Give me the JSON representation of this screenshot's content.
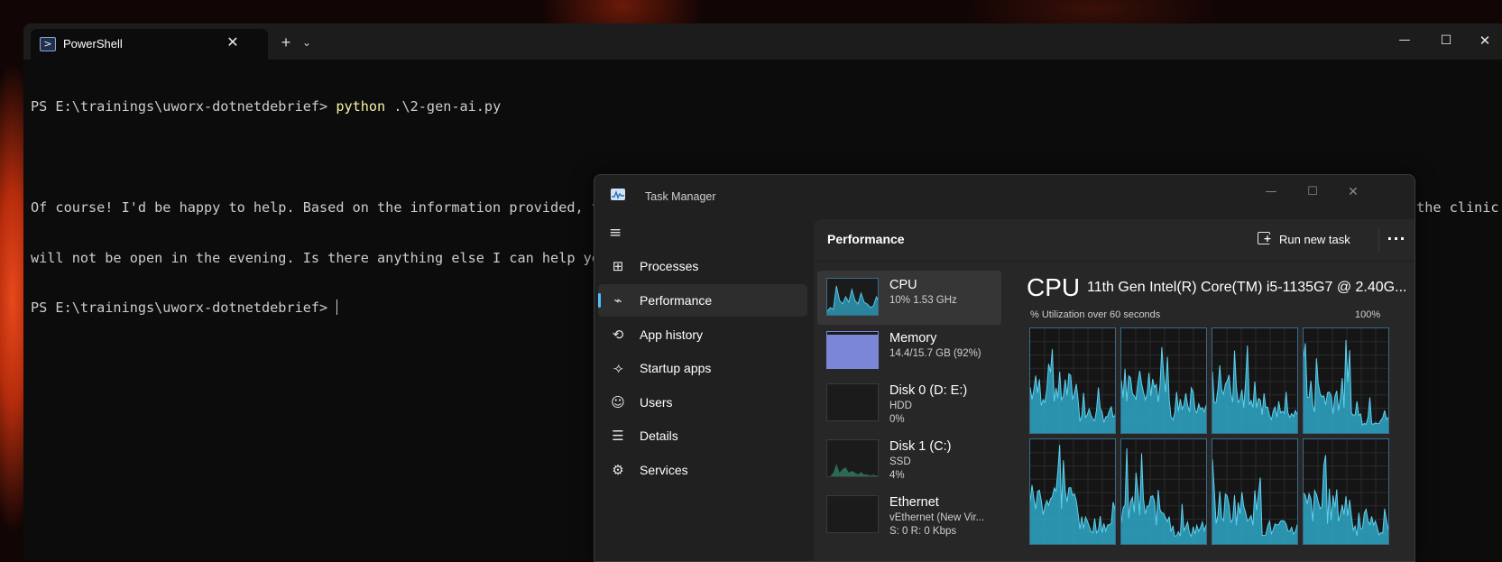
{
  "terminal": {
    "tab_title": "PowerShell",
    "tab_icon": "powershell-icon",
    "close_tab": "✕",
    "new_tab": "+",
    "dropdown": "⌄",
    "minimize": "—",
    "maximize": "☐",
    "close": "✕",
    "prompt": "PS E:\\trainings\\uworx-dotnetdebrief> ",
    "command_name": "python",
    "command_args": " .\\2-gen-ai.py",
    "output_line1": "Of course! I'd be happy to help. Based on the information provided, the clinic does not open in the evening on Thursdays and Fridays. Since today is Friday, that means the clinic",
    "output_line2": "will not be open in the evening. Is there anything else I can help you with?",
    "prompt2": "PS E:\\trainings\\uworx-dotnetdebrief> "
  },
  "taskmanager": {
    "title": "Task Manager",
    "minimize": "—",
    "maximize": "☐",
    "close": "✕",
    "nav": [
      {
        "label": "Processes",
        "icon": "processes-icon",
        "glyph": "⊞"
      },
      {
        "label": "Performance",
        "icon": "performance-icon",
        "glyph": "⌁",
        "active": true
      },
      {
        "label": "App history",
        "icon": "app-history-icon",
        "glyph": "⟲"
      },
      {
        "label": "Startup apps",
        "icon": "startup-apps-icon",
        "glyph": "⟢"
      },
      {
        "label": "Users",
        "icon": "users-icon",
        "glyph": "☺"
      },
      {
        "label": "Details",
        "icon": "details-icon",
        "glyph": "☰"
      },
      {
        "label": "Services",
        "icon": "services-icon",
        "glyph": "⚙"
      }
    ],
    "performance": {
      "title": "Performance",
      "run_new_task": "Run new task",
      "more": "···",
      "resources": [
        {
          "name": "CPU",
          "line1": "10%  1.53 GHz",
          "line2": ""
        },
        {
          "name": "Memory",
          "line1": "14.4/15.7 GB (92%)",
          "line2": ""
        },
        {
          "name": "Disk 0 (D: E:)",
          "line1": "HDD",
          "line2": "0%"
        },
        {
          "name": "Disk 1 (C:)",
          "line1": "SSD",
          "line2": "4%"
        },
        {
          "name": "Ethernet",
          "line1": "vEthernet (New Vir...",
          "line2": "S: 0 R: 0 Kbps"
        }
      ],
      "cpu_heading": "CPU",
      "cpu_model": "11th Gen Intel(R) Core(TM) i5-1135G7 @ 2.40G...",
      "util_label": "% Utilization over 60 seconds",
      "util_max": "100%",
      "accent": "#4cc2ff",
      "graph_color": "#2fa8c8",
      "memory_color": "#7b86d6"
    }
  }
}
